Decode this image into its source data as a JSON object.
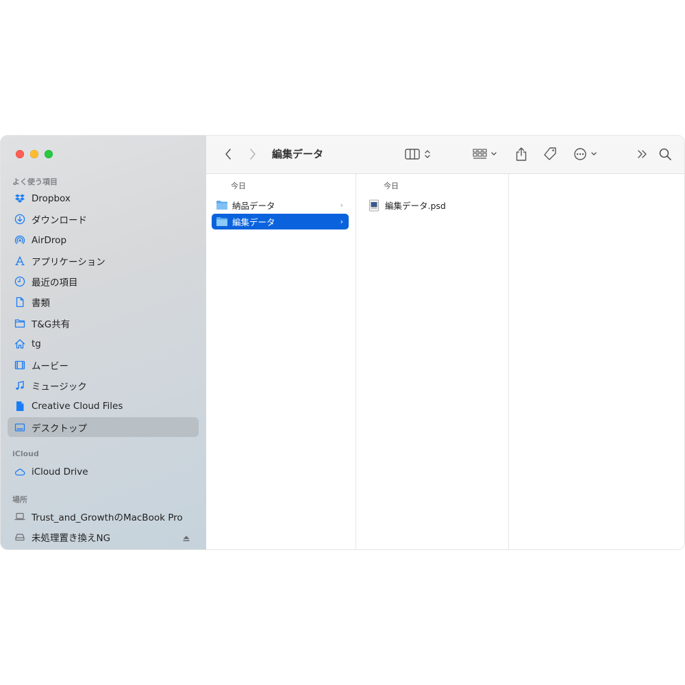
{
  "window": {
    "title": "編集データ"
  },
  "sidebar": {
    "sections": [
      {
        "header": "よく使う項目",
        "items": [
          {
            "label": "Dropbox",
            "icon": "dropbox-icon"
          },
          {
            "label": "ダウンロード",
            "icon": "download-icon"
          },
          {
            "label": "AirDrop",
            "icon": "airdrop-icon"
          },
          {
            "label": "アプリケーション",
            "icon": "applications-icon"
          },
          {
            "label": "最近の項目",
            "icon": "clock-icon"
          },
          {
            "label": "書類",
            "icon": "document-icon"
          },
          {
            "label": "T&G共有",
            "icon": "folder-icon"
          },
          {
            "label": "tg",
            "icon": "home-icon"
          },
          {
            "label": "ムービー",
            "icon": "film-icon"
          },
          {
            "label": "ミュージック",
            "icon": "music-note-icon"
          },
          {
            "label": "Creative Cloud Files",
            "icon": "file-icon"
          },
          {
            "label": "デスクトップ",
            "icon": "desktop-icon",
            "selected": true
          }
        ]
      },
      {
        "header": "iCloud",
        "items": [
          {
            "label": "iCloud Drive",
            "icon": "cloud-icon"
          }
        ]
      },
      {
        "header": "場所",
        "items": [
          {
            "label": "Trust_and_GrowthのMacBook Pro",
            "icon": "laptop-icon"
          },
          {
            "label": "未処理置き換えNG",
            "icon": "external-drive-icon",
            "eject": true
          }
        ]
      }
    ]
  },
  "columns": [
    {
      "header": "今日",
      "rows": [
        {
          "label": "納品データ",
          "icon": "folder-icon",
          "selected": false,
          "has_children": true
        },
        {
          "label": "編集データ",
          "icon": "folder-icon",
          "selected": true,
          "has_children": true
        }
      ]
    },
    {
      "header": "今日",
      "rows": [
        {
          "label": "編集データ.psd",
          "icon": "psd-file-icon",
          "selected": false,
          "has_children": false
        }
      ]
    }
  ],
  "colors": {
    "accent": "#0a63dd",
    "sidebar_icon": "#1a7cf5",
    "traffic_close": "#fe5f57",
    "traffic_min": "#febc2e",
    "traffic_max": "#28c840"
  }
}
